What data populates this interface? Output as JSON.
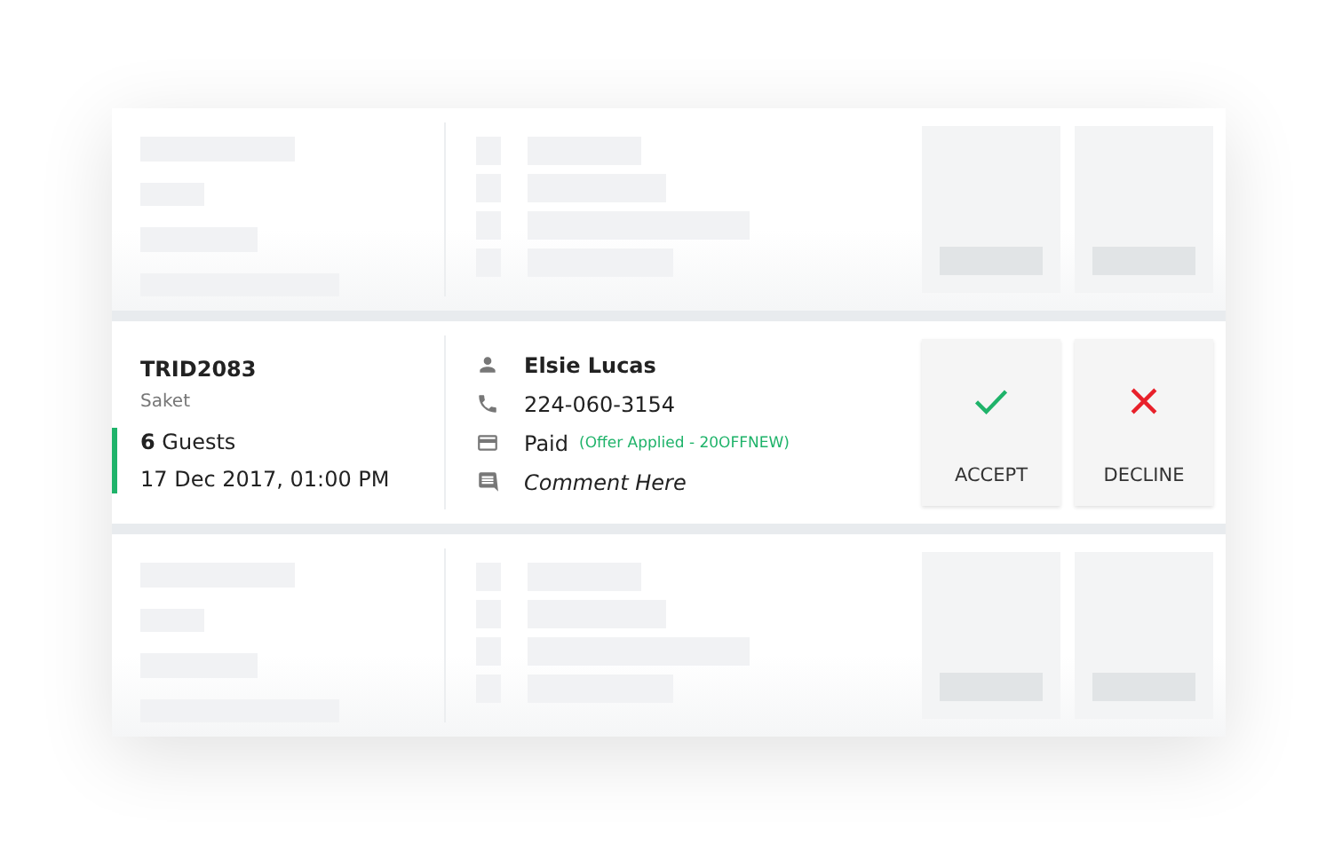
{
  "rows": [
    {
      "kind": "placeholder"
    },
    {
      "kind": "booking",
      "id": "TRID2083",
      "location": "Saket",
      "guests": "**6** Guests",
      "datetime": "17 Dec 2017, 01:00 PM",
      "color": "#1fb36a",
      "name": "Elsie Lucas",
      "phone": "224-060-3154",
      "payment": "Paid",
      "offer": "(Offer Applied - 20OFFNEW)",
      "comment": "Comment Here",
      "actions": [
        {
          "kind": "accept",
          "label": "ACCEPT"
        },
        {
          "kind": "decline",
          "label": "DECLINE"
        }
      ]
    },
    {
      "kind": "placeholder"
    }
  ]
}
